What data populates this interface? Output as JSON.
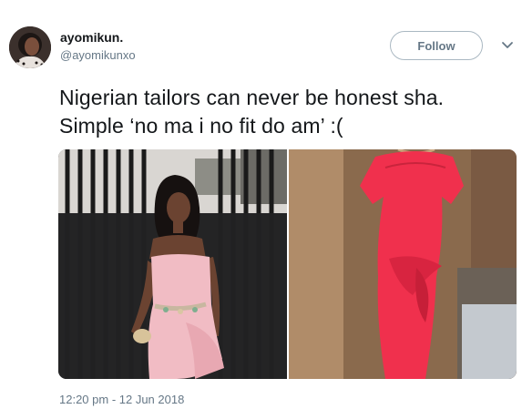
{
  "tweet": {
    "author": {
      "display_name": "ayomikun.",
      "handle": "@ayomikunxo",
      "avatar_icon": "user-avatar"
    },
    "follow_button_label": "Follow",
    "menu_icon": "chevron-down-icon",
    "text_lines": [
      "Nigerian tailors can never be honest sha.",
      "Simple ‘no ma i no fit do am’ :("
    ],
    "media": [
      {
        "icon": "photo-pink-dress-icon"
      },
      {
        "icon": "photo-red-dress-icon"
      }
    ],
    "timestamp": "12:20 pm - 12 Jun 2018"
  },
  "colors": {
    "text_primary": "#14171a",
    "text_secondary": "#657786",
    "button_border": "#aab8c2",
    "background": "#ffffff"
  }
}
